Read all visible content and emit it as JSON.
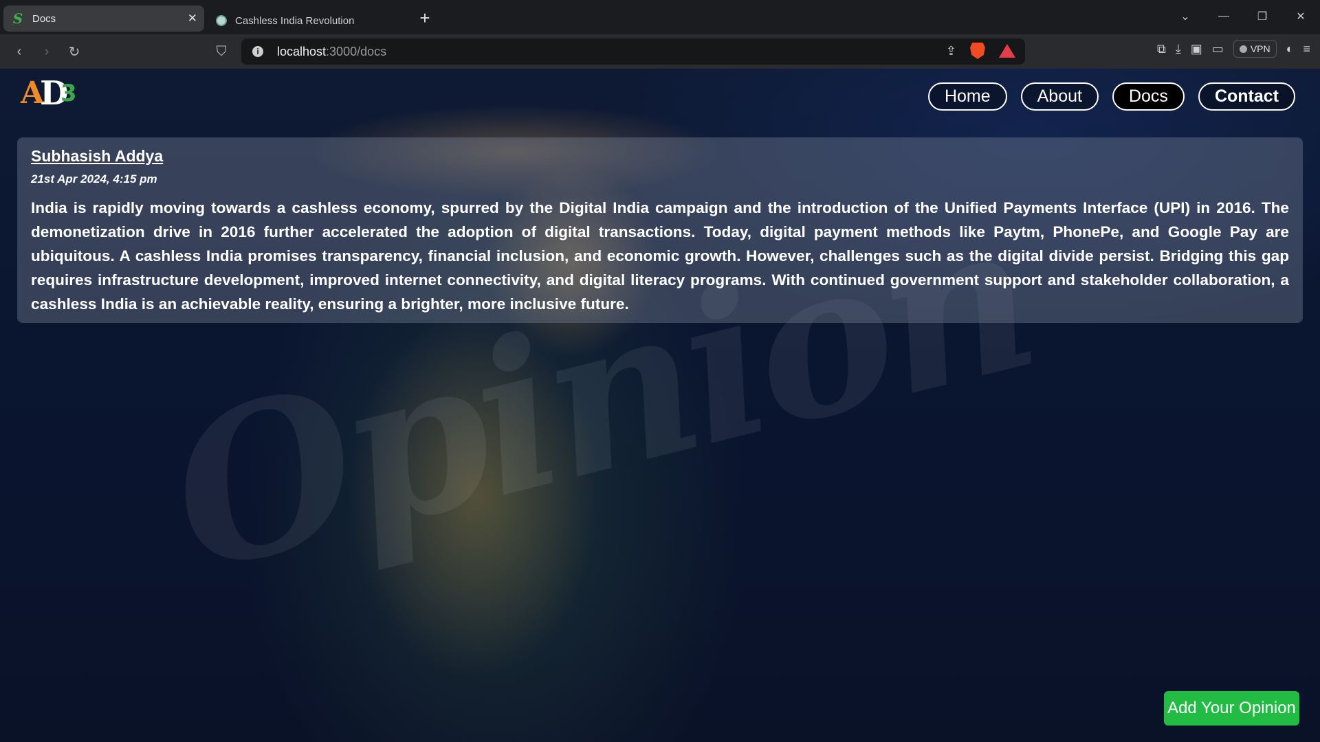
{
  "browser": {
    "tabs": [
      {
        "label": "Docs",
        "favicon": "S",
        "active": true
      },
      {
        "label": "Cashless India Revolution",
        "favicon": "chatgpt-icon",
        "active": false
      }
    ],
    "new_tab": "+",
    "url_host": "localhost",
    "url_path": ":3000/docs",
    "vpn_label": "VPN"
  },
  "site": {
    "logo": {
      "a": "A",
      "d": "D",
      "three": "3"
    },
    "nav": [
      "Home",
      "About",
      "Docs",
      "Contact"
    ],
    "watermark": "Opinion"
  },
  "post": {
    "author": "Subhasish Addya",
    "date": "21st Apr 2024, 4:15 pm",
    "body": "India is rapidly moving towards a cashless economy, spurred by the Digital India campaign and the introduction of the Unified Payments Interface (UPI) in 2016. The demonetization drive in 2016 further accelerated the adoption of digital transactions. Today, digital payment methods like Paytm, PhonePe, and Google Pay are ubiquitous. A cashless India promises transparency, financial inclusion, and economic growth. However, challenges such as the digital divide persist. Bridging this gap requires infrastructure development, improved internet connectivity, and digital literacy programs. With continued government support and stakeholder collaboration, a cashless India is an achievable reality, ensuring a brighter, more inclusive future."
  },
  "actions": {
    "add_opinion": "Add Your Opinion"
  },
  "colors": {
    "accent_green": "#22bb44",
    "logo_orange": "#f08a24",
    "logo_green": "#3aa84a"
  }
}
